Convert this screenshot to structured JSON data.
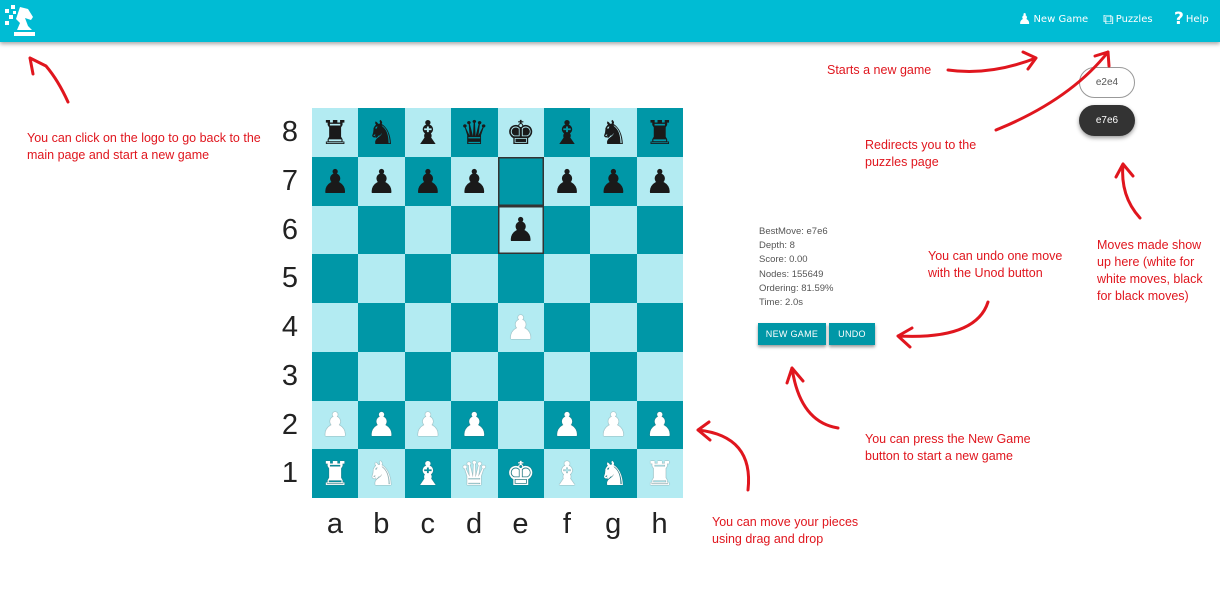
{
  "navbar": {
    "logo_icon": "chess-knight-pixel-logo",
    "new_game_label": "New Game",
    "new_game_icon": "pawn-king-icon",
    "puzzles_label": "Puzzles",
    "puzzles_icon": "puzzle-piece-icon",
    "help_label": "Help",
    "help_icon": "question-mark-icon",
    "color": "#00bcd4"
  },
  "board": {
    "rows": [
      [
        "r",
        "n",
        "b",
        "q",
        "k",
        "b",
        "n",
        "r"
      ],
      [
        "p",
        "p",
        "p",
        "p",
        "",
        "p",
        "p",
        "p"
      ],
      [
        "",
        "",
        "",
        "",
        "p",
        "",
        "",
        ""
      ],
      [
        "",
        "",
        "",
        "",
        "",
        "",
        "",
        ""
      ],
      [
        "",
        "",
        "",
        "",
        "P",
        "",
        "",
        ""
      ],
      [
        "",
        "",
        "",
        "",
        "",
        "",
        "",
        ""
      ],
      [
        "P",
        "P",
        "P",
        "P",
        "",
        "P",
        "P",
        "P"
      ],
      [
        "R",
        "N",
        "B",
        "Q",
        "K",
        "B",
        "N",
        "R"
      ]
    ],
    "highlighted": [
      "e7",
      "e6"
    ],
    "ranks": [
      "8",
      "7",
      "6",
      "5",
      "4",
      "3",
      "2",
      "1"
    ],
    "files": [
      "a",
      "b",
      "c",
      "d",
      "e",
      "f",
      "g",
      "h"
    ],
    "light_color": "#b3ebf2",
    "dark_color": "#0097a7"
  },
  "stats": {
    "best_move": "BestMove: e7e6",
    "depth": "Depth: 8",
    "score": "Score: 0.00",
    "nodes": "Nodes: 155649",
    "ordering": "Ordering: 81.59%",
    "time": "Time: 2.0s"
  },
  "buttons": {
    "new_game": "NEW GAME",
    "undo": "UNDO"
  },
  "moves": {
    "white": "e2e4",
    "black": "e7e6"
  },
  "annotations": {
    "logo": "You can click on the logo to go back to the main page and start a new game",
    "new_game": "Starts a new game",
    "puzzles": "Redirects you to the puzzles page",
    "undo": "You can undo one move with the Unod button",
    "moves": "Moves made show up here (white for white moves, black for black moves)",
    "new_game_button": "You can press the New Game button to start a new game",
    "drag": "You can move your pieces using drag and drop",
    "color": "#e0161e"
  }
}
